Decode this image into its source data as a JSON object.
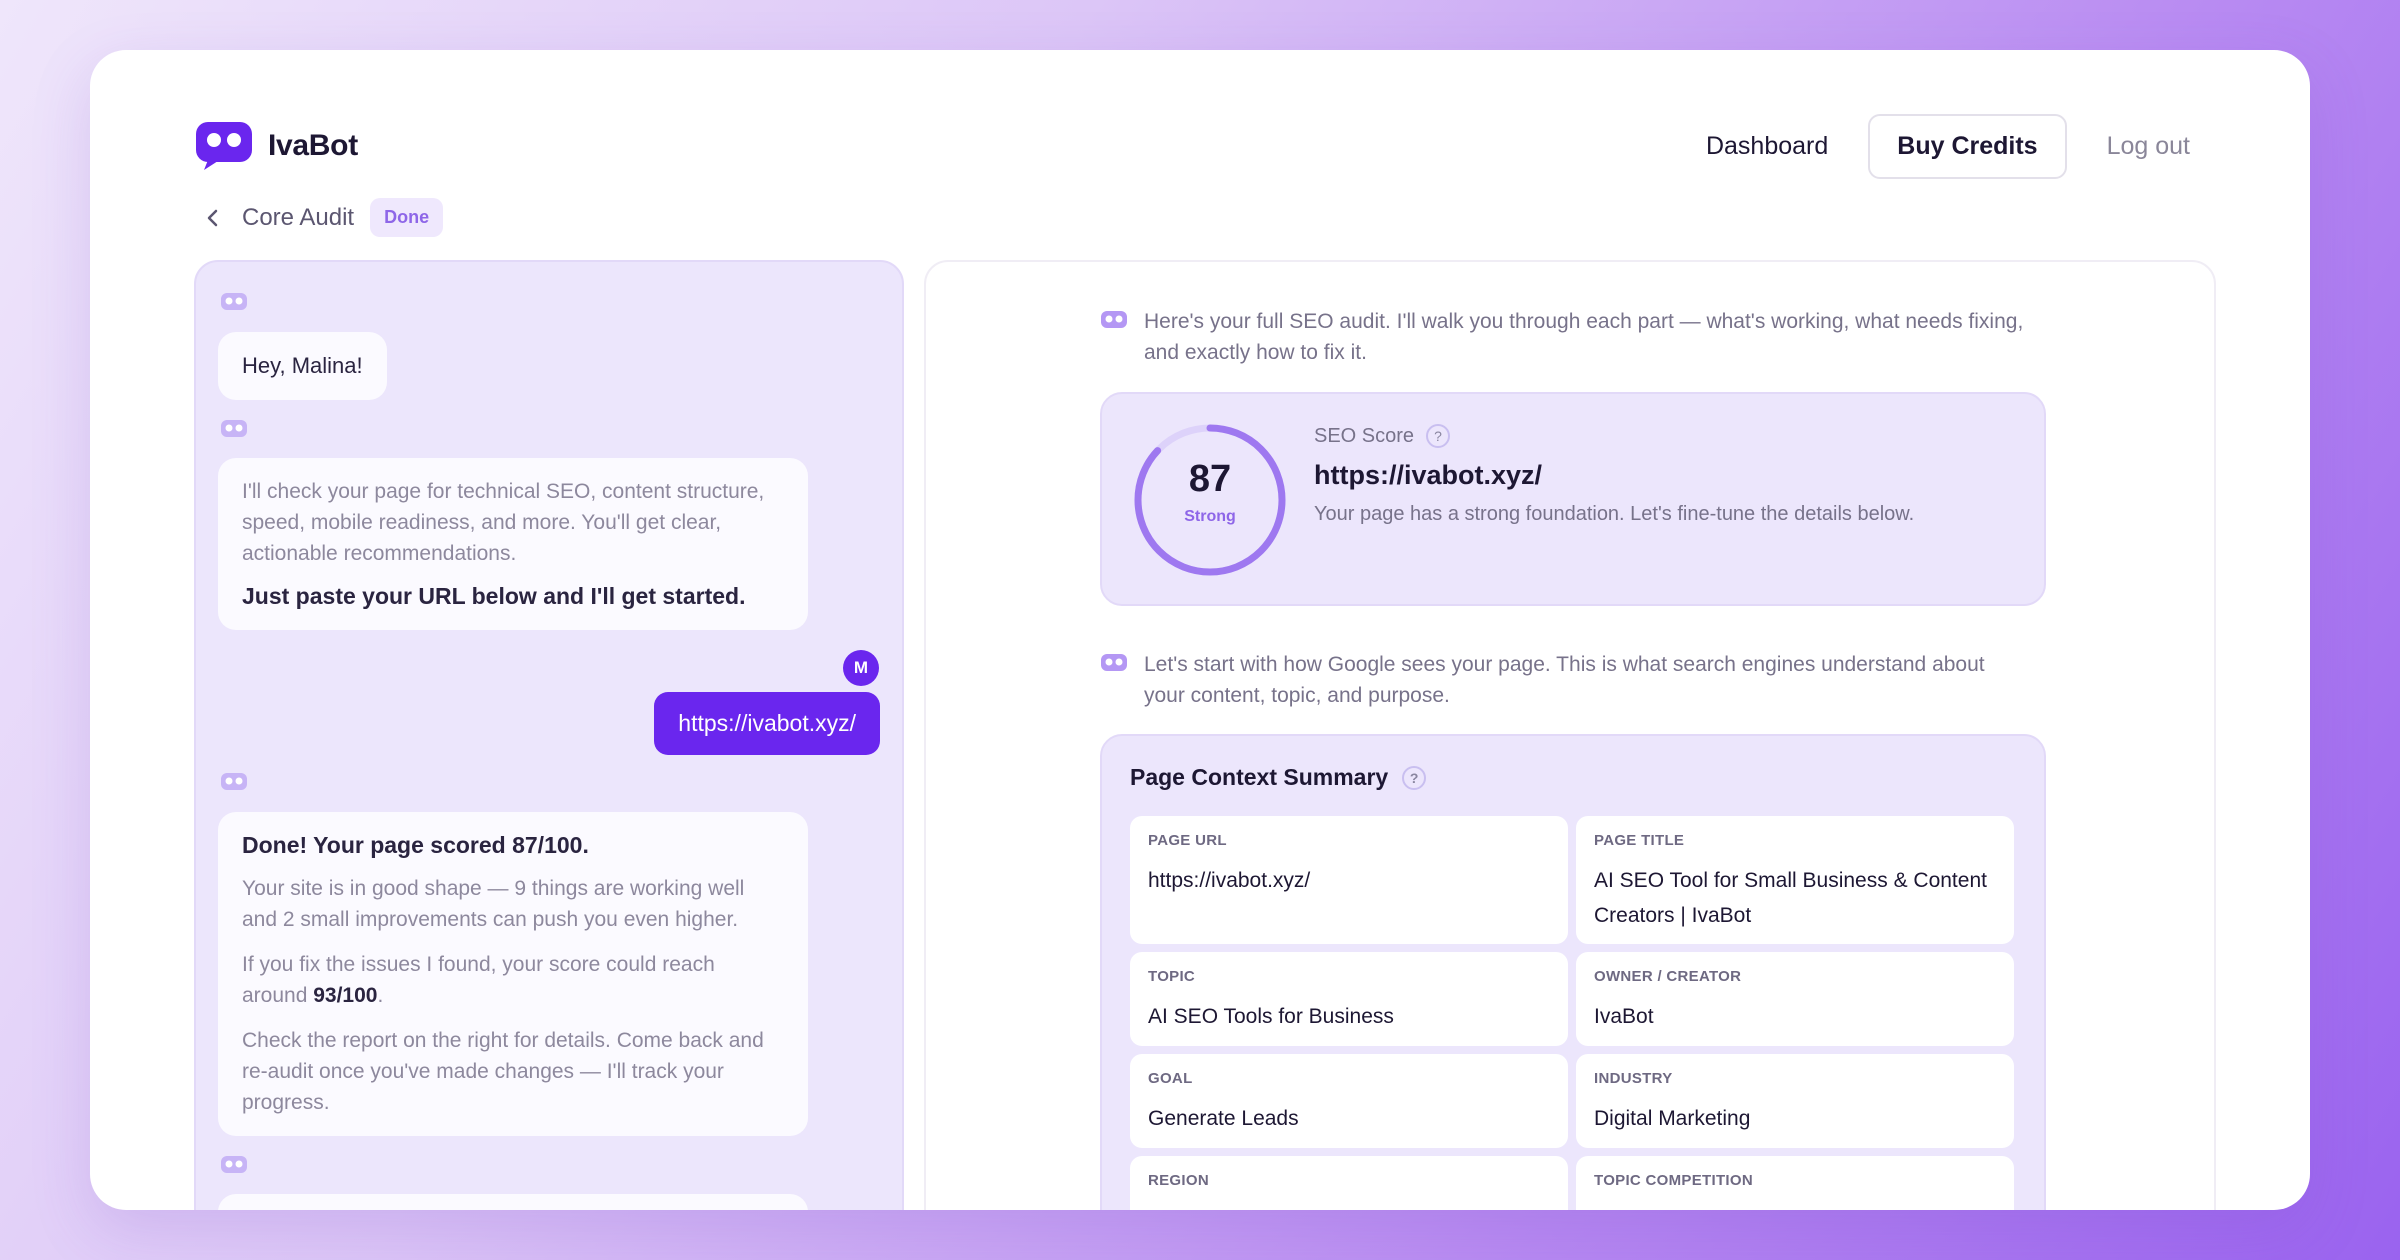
{
  "app": {
    "name": "IvaBot"
  },
  "nav": {
    "dashboard": "Dashboard",
    "buy_credits": "Buy Credits",
    "logout": "Log out"
  },
  "breadcrumb": {
    "title": "Core Audit",
    "status": "Done"
  },
  "chat": {
    "greeting": "Hey, Malina!",
    "intro_text": "I'll check your page for technical SEO, content structure, speed, mobile readiness, and more. You'll get clear, actionable recommendations.",
    "intro_cta": "Just paste your URL below and I'll get started.",
    "user_initial": "M",
    "user_message": "https://ivabot.xyz/",
    "result_title": "Done! Your page scored 87/100.",
    "result_p1": "Your site is in good shape — 9 things are working well and 2 small improvements can push you even higher.",
    "result_p2_prefix": "If you fix the issues I found, your score could reach around",
    "result_p2_score": "93/100",
    "result_p2_suffix": ".",
    "result_p3": "Check the report on the right for details. Come back and re-audit once you've made changes — I'll track your progress."
  },
  "report": {
    "intro1": "Here's your full SEO audit. I'll walk you through each part — what's working, what needs fixing, and exactly how to fix it.",
    "score": {
      "label": "SEO Score",
      "help": "?",
      "value": "87",
      "value_numeric": 87,
      "max": 100,
      "grade": "Strong",
      "url": "https://ivabot.xyz/",
      "description": "Your page has a strong foundation. Let's fine-tune the details below."
    },
    "intro2": "Let's start with how Google sees your page. This is what search engines understand about your content, topic, and purpose.",
    "context": {
      "title": "Page Context Summary",
      "help": "?",
      "fields": [
        {
          "key": "PAGE URL",
          "value": "https://ivabot.xyz/"
        },
        {
          "key": "PAGE TITLE",
          "value": "AI SEO Tool for Small Business & Content Creators | IvaBot"
        },
        {
          "key": "TOPIC",
          "value": "AI SEO Tools for Business"
        },
        {
          "key": "OWNER / CREATOR",
          "value": "IvaBot"
        },
        {
          "key": "GOAL",
          "value": "Generate Leads"
        },
        {
          "key": "INDUSTRY",
          "value": "Digital Marketing"
        },
        {
          "key": "REGION",
          "value": ""
        },
        {
          "key": "TOPIC COMPETITION",
          "value": ""
        }
      ]
    }
  },
  "colors": {
    "accent": "#6a26ee",
    "panel": "#ece6fc",
    "ring": "#9e78f0"
  },
  "icons": {
    "logo": "robot-logo-icon",
    "back": "chevron-left-icon",
    "bot": "bot-avatar-icon",
    "help": "question-icon"
  }
}
